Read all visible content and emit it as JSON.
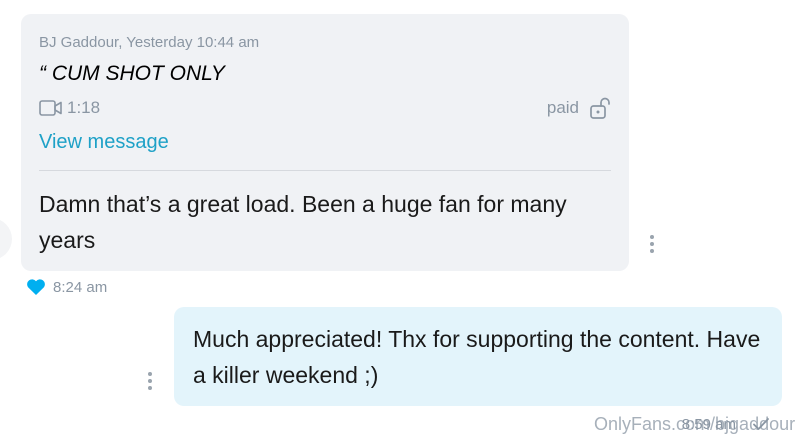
{
  "incoming": {
    "quoted": {
      "header": "BJ Gaddour, Yesterday 10:44 am",
      "title": "“ CUM SHOT ONLY",
      "media_icon": "video-icon",
      "duration": "1:18",
      "paid_label": "paid",
      "lock_icon": "unlock-icon",
      "view_link": "View message"
    },
    "message": "Damn that’s a great load. Been a huge fan for many years",
    "time": "8:24 am",
    "liked": true
  },
  "outgoing": {
    "message": "Much appreciated! Thx for supporting the content. Have a killer weekend ;)",
    "time": "8:59 am"
  },
  "watermark": "OnlyFans.com/bjgaddour",
  "colors": {
    "incoming_bubble": "#f0f2f5",
    "outgoing_bubble": "#e3f4fb",
    "accent": "#1ea1c7",
    "heart": "#00aff0",
    "muted": "#8a96a3"
  }
}
